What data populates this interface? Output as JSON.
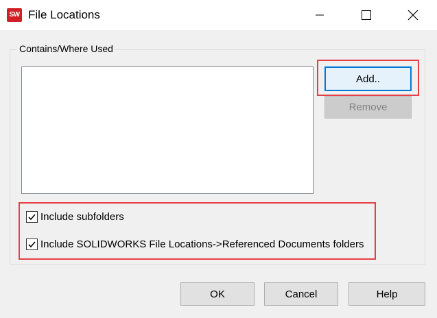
{
  "window": {
    "app_icon_text": "SW",
    "title": "File Locations",
    "controls": [
      "minimize",
      "maximize",
      "close"
    ]
  },
  "group": {
    "legend": "Contains/Where Used",
    "list_items": []
  },
  "buttons": {
    "add": "Add..",
    "remove": "Remove",
    "ok": "OK",
    "cancel": "Cancel",
    "help": "Help"
  },
  "options": {
    "include_subfolders": {
      "label": "Include subfolders",
      "checked": true
    },
    "include_referenced": {
      "label": "Include SOLIDWORKS File Locations->Referenced Documents folders",
      "checked": true
    }
  },
  "colors": {
    "highlight": "#e53e44",
    "brand": "#d11f26",
    "focus": "#0078d7"
  }
}
